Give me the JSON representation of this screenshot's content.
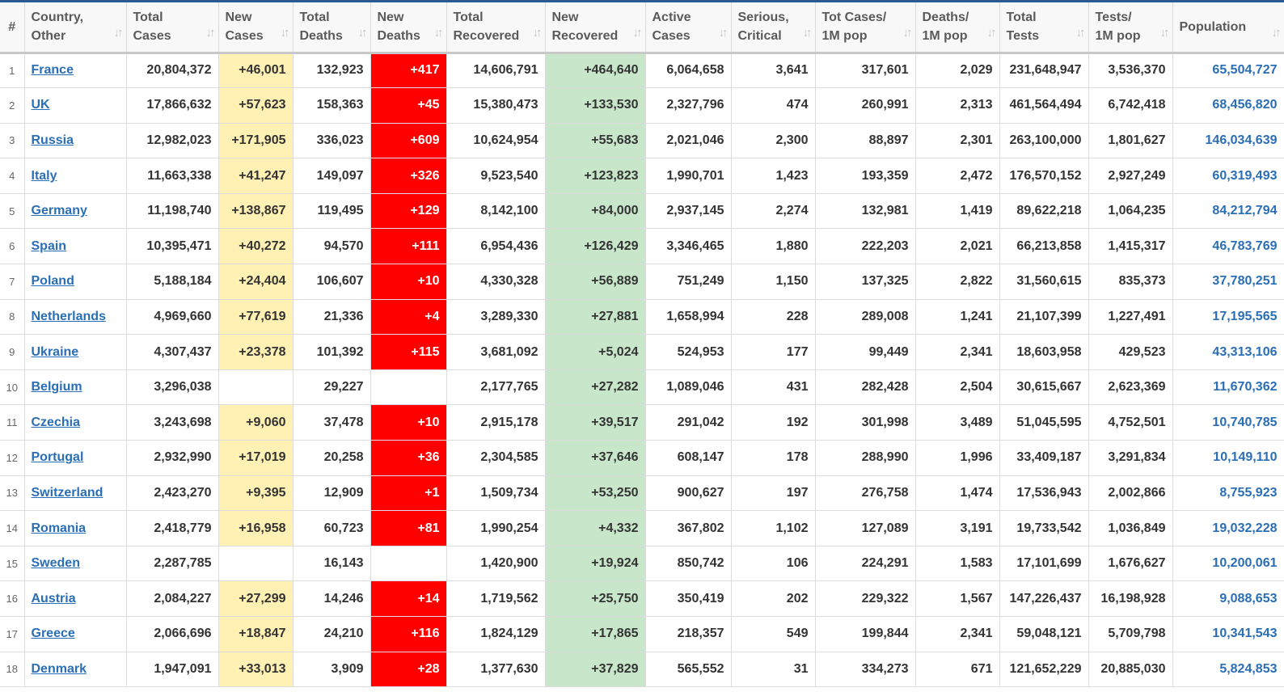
{
  "headers": [
    {
      "line1": "#",
      "line2": "",
      "sort": false
    },
    {
      "line1": "Country,",
      "line2": "Other",
      "sort": true
    },
    {
      "line1": "Total",
      "line2": "Cases",
      "sort": true
    },
    {
      "line1": "New",
      "line2": "Cases",
      "sort": true
    },
    {
      "line1": "Total",
      "line2": "Deaths",
      "sort": true
    },
    {
      "line1": "New",
      "line2": "Deaths",
      "sort": true
    },
    {
      "line1": "Total",
      "line2": "Recovered",
      "sort": true
    },
    {
      "line1": "New",
      "line2": "Recovered",
      "sort": true
    },
    {
      "line1": "Active",
      "line2": "Cases",
      "sort": true
    },
    {
      "line1": "Serious,",
      "line2": "Critical",
      "sort": true
    },
    {
      "line1": "Tot Cases/",
      "line2": "1M pop",
      "sort": true
    },
    {
      "line1": "Deaths/",
      "line2": "1M pop",
      "sort": true
    },
    {
      "line1": "Total",
      "line2": "Tests",
      "sort": true
    },
    {
      "line1": "Tests/",
      "line2": "1M pop",
      "sort": true
    },
    {
      "line1": "Population",
      "line2": "",
      "sort": true
    }
  ],
  "colors": {
    "new_cases_bg": "#fff0b4",
    "new_deaths_bg": "#ff0000",
    "new_recovered_bg": "#c8e6c9",
    "link": "#2a6eb5",
    "top_border": "#2a5a8f"
  },
  "rows": [
    {
      "idx": "1",
      "country": "France",
      "total_cases": "20,804,372",
      "new_cases": "+46,001",
      "total_deaths": "132,923",
      "new_deaths": "+417",
      "total_recovered": "14,606,791",
      "new_recovered": "+464,640",
      "active": "6,064,658",
      "serious": "3,641",
      "cases_1m": "317,601",
      "deaths_1m": "2,029",
      "total_tests": "231,648,947",
      "tests_1m": "3,536,370",
      "population": "65,504,727"
    },
    {
      "idx": "2",
      "country": "UK",
      "total_cases": "17,866,632",
      "new_cases": "+57,623",
      "total_deaths": "158,363",
      "new_deaths": "+45",
      "total_recovered": "15,380,473",
      "new_recovered": "+133,530",
      "active": "2,327,796",
      "serious": "474",
      "cases_1m": "260,991",
      "deaths_1m": "2,313",
      "total_tests": "461,564,494",
      "tests_1m": "6,742,418",
      "population": "68,456,820"
    },
    {
      "idx": "3",
      "country": "Russia",
      "total_cases": "12,982,023",
      "new_cases": "+171,905",
      "total_deaths": "336,023",
      "new_deaths": "+609",
      "total_recovered": "10,624,954",
      "new_recovered": "+55,683",
      "active": "2,021,046",
      "serious": "2,300",
      "cases_1m": "88,897",
      "deaths_1m": "2,301",
      "total_tests": "263,100,000",
      "tests_1m": "1,801,627",
      "population": "146,034,639"
    },
    {
      "idx": "4",
      "country": "Italy",
      "total_cases": "11,663,338",
      "new_cases": "+41,247",
      "total_deaths": "149,097",
      "new_deaths": "+326",
      "total_recovered": "9,523,540",
      "new_recovered": "+123,823",
      "active": "1,990,701",
      "serious": "1,423",
      "cases_1m": "193,359",
      "deaths_1m": "2,472",
      "total_tests": "176,570,152",
      "tests_1m": "2,927,249",
      "population": "60,319,493"
    },
    {
      "idx": "5",
      "country": "Germany",
      "total_cases": "11,198,740",
      "new_cases": "+138,867",
      "total_deaths": "119,495",
      "new_deaths": "+129",
      "total_recovered": "8,142,100",
      "new_recovered": "+84,000",
      "active": "2,937,145",
      "serious": "2,274",
      "cases_1m": "132,981",
      "deaths_1m": "1,419",
      "total_tests": "89,622,218",
      "tests_1m": "1,064,235",
      "population": "84,212,794"
    },
    {
      "idx": "6",
      "country": "Spain",
      "total_cases": "10,395,471",
      "new_cases": "+40,272",
      "total_deaths": "94,570",
      "new_deaths": "+111",
      "total_recovered": "6,954,436",
      "new_recovered": "+126,429",
      "active": "3,346,465",
      "serious": "1,880",
      "cases_1m": "222,203",
      "deaths_1m": "2,021",
      "total_tests": "66,213,858",
      "tests_1m": "1,415,317",
      "population": "46,783,769"
    },
    {
      "idx": "7",
      "country": "Poland",
      "total_cases": "5,188,184",
      "new_cases": "+24,404",
      "total_deaths": "106,607",
      "new_deaths": "+10",
      "total_recovered": "4,330,328",
      "new_recovered": "+56,889",
      "active": "751,249",
      "serious": "1,150",
      "cases_1m": "137,325",
      "deaths_1m": "2,822",
      "total_tests": "31,560,615",
      "tests_1m": "835,373",
      "population": "37,780,251"
    },
    {
      "idx": "8",
      "country": "Netherlands",
      "total_cases": "4,969,660",
      "new_cases": "+77,619",
      "total_deaths": "21,336",
      "new_deaths": "+4",
      "total_recovered": "3,289,330",
      "new_recovered": "+27,881",
      "active": "1,658,994",
      "serious": "228",
      "cases_1m": "289,008",
      "deaths_1m": "1,241",
      "total_tests": "21,107,399",
      "tests_1m": "1,227,491",
      "population": "17,195,565"
    },
    {
      "idx": "9",
      "country": "Ukraine",
      "total_cases": "4,307,437",
      "new_cases": "+23,378",
      "total_deaths": "101,392",
      "new_deaths": "+115",
      "total_recovered": "3,681,092",
      "new_recovered": "+5,024",
      "active": "524,953",
      "serious": "177",
      "cases_1m": "99,449",
      "deaths_1m": "2,341",
      "total_tests": "18,603,958",
      "tests_1m": "429,523",
      "population": "43,313,106"
    },
    {
      "idx": "10",
      "country": "Belgium",
      "total_cases": "3,296,038",
      "new_cases": "",
      "total_deaths": "29,227",
      "new_deaths": "",
      "total_recovered": "2,177,765",
      "new_recovered": "+27,282",
      "active": "1,089,046",
      "serious": "431",
      "cases_1m": "282,428",
      "deaths_1m": "2,504",
      "total_tests": "30,615,667",
      "tests_1m": "2,623,369",
      "population": "11,670,362"
    },
    {
      "idx": "11",
      "country": "Czechia",
      "total_cases": "3,243,698",
      "new_cases": "+9,060",
      "total_deaths": "37,478",
      "new_deaths": "+10",
      "total_recovered": "2,915,178",
      "new_recovered": "+39,517",
      "active": "291,042",
      "serious": "192",
      "cases_1m": "301,998",
      "deaths_1m": "3,489",
      "total_tests": "51,045,595",
      "tests_1m": "4,752,501",
      "population": "10,740,785"
    },
    {
      "idx": "12",
      "country": "Portugal",
      "total_cases": "2,932,990",
      "new_cases": "+17,019",
      "total_deaths": "20,258",
      "new_deaths": "+36",
      "total_recovered": "2,304,585",
      "new_recovered": "+37,646",
      "active": "608,147",
      "serious": "178",
      "cases_1m": "288,990",
      "deaths_1m": "1,996",
      "total_tests": "33,409,187",
      "tests_1m": "3,291,834",
      "population": "10,149,110"
    },
    {
      "idx": "13",
      "country": "Switzerland",
      "total_cases": "2,423,270",
      "new_cases": "+9,395",
      "total_deaths": "12,909",
      "new_deaths": "+1",
      "total_recovered": "1,509,734",
      "new_recovered": "+53,250",
      "active": "900,627",
      "serious": "197",
      "cases_1m": "276,758",
      "deaths_1m": "1,474",
      "total_tests": "17,536,943",
      "tests_1m": "2,002,866",
      "population": "8,755,923"
    },
    {
      "idx": "14",
      "country": "Romania",
      "total_cases": "2,418,779",
      "new_cases": "+16,958",
      "total_deaths": "60,723",
      "new_deaths": "+81",
      "total_recovered": "1,990,254",
      "new_recovered": "+4,332",
      "active": "367,802",
      "serious": "1,102",
      "cases_1m": "127,089",
      "deaths_1m": "3,191",
      "total_tests": "19,733,542",
      "tests_1m": "1,036,849",
      "population": "19,032,228"
    },
    {
      "idx": "15",
      "country": "Sweden",
      "total_cases": "2,287,785",
      "new_cases": "",
      "total_deaths": "16,143",
      "new_deaths": "",
      "total_recovered": "1,420,900",
      "new_recovered": "+19,924",
      "active": "850,742",
      "serious": "106",
      "cases_1m": "224,291",
      "deaths_1m": "1,583",
      "total_tests": "17,101,699",
      "tests_1m": "1,676,627",
      "population": "10,200,061"
    },
    {
      "idx": "16",
      "country": "Austria",
      "total_cases": "2,084,227",
      "new_cases": "+27,299",
      "total_deaths": "14,246",
      "new_deaths": "+14",
      "total_recovered": "1,719,562",
      "new_recovered": "+25,750",
      "active": "350,419",
      "serious": "202",
      "cases_1m": "229,322",
      "deaths_1m": "1,567",
      "total_tests": "147,226,437",
      "tests_1m": "16,198,928",
      "population": "9,088,653"
    },
    {
      "idx": "17",
      "country": "Greece",
      "total_cases": "2,066,696",
      "new_cases": "+18,847",
      "total_deaths": "24,210",
      "new_deaths": "+116",
      "total_recovered": "1,824,129",
      "new_recovered": "+17,865",
      "active": "218,357",
      "serious": "549",
      "cases_1m": "199,844",
      "deaths_1m": "2,341",
      "total_tests": "59,048,121",
      "tests_1m": "5,709,798",
      "population": "10,341,543"
    },
    {
      "idx": "18",
      "country": "Denmark",
      "total_cases": "1,947,091",
      "new_cases": "+33,013",
      "total_deaths": "3,909",
      "new_deaths": "+28",
      "total_recovered": "1,377,630",
      "new_recovered": "+37,829",
      "active": "565,552",
      "serious": "31",
      "cases_1m": "334,273",
      "deaths_1m": "671",
      "total_tests": "121,652,229",
      "tests_1m": "20,885,030",
      "population": "5,824,853"
    }
  ]
}
